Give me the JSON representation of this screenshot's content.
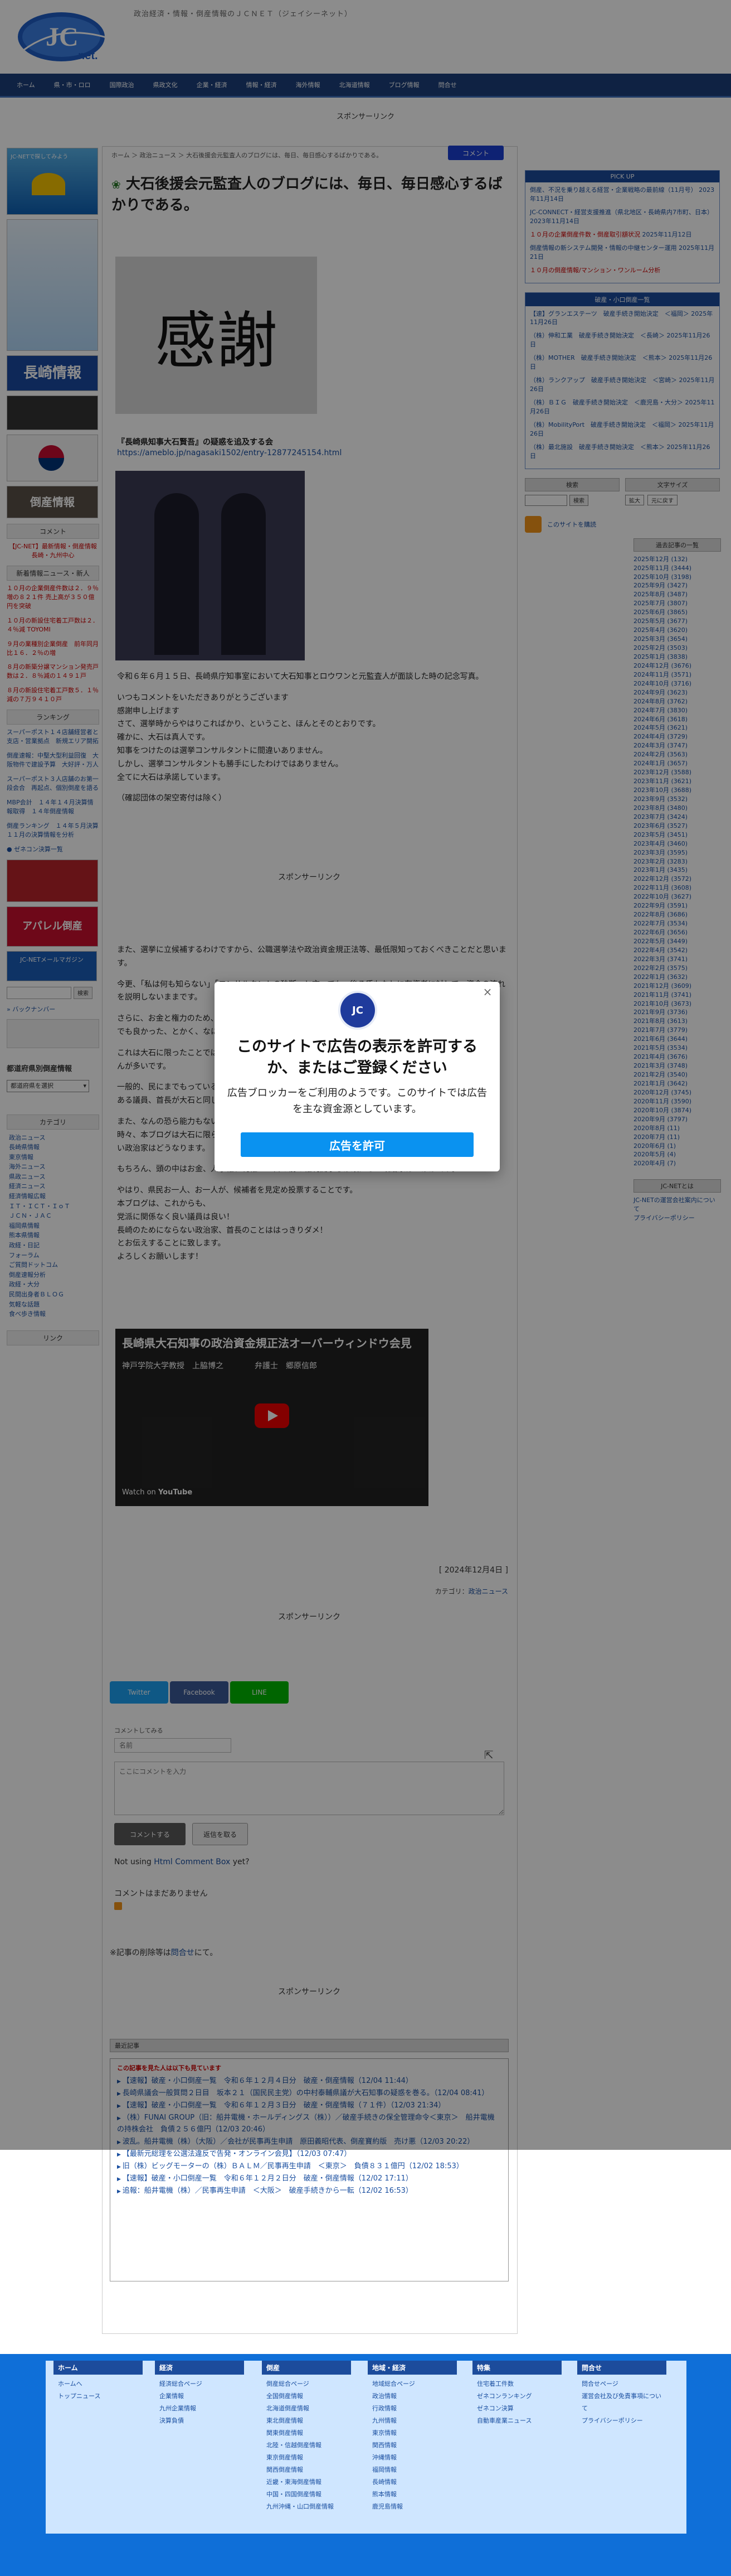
{
  "header": {
    "logo_text": "JC",
    "logo_subtext": "net.",
    "tagline": "政治経済・情報・倒産情報のＪＣＮＥＴ（ジェイシーネット）"
  },
  "nav": [
    "ホーム",
    "県・市・ロロ",
    "国際政治",
    "県政文化",
    "企業・経済",
    "情報・経済",
    "海外情報",
    "北海道情報",
    "ブログ情報",
    "問合せ"
  ],
  "sponsor_label": "スポンサーリンク",
  "breadcrumb": "ホーム ＞ 政治ニュース ＞ 大石後援会元監査人のブログには、毎日、毎日感心するばかりである。",
  "comment_button": "コメント",
  "post": {
    "title": "大石後援会元監査人のブログには、毎日、毎日感心するばかりである。",
    "kansha_char": "感謝",
    "headline": "『長崎県知事大石賢吾』の疑惑を追及する会",
    "url": "https://ameblo.jp/nagasaki1502/entry-12877245154.html",
    "body1": [
      "令和６年６月１５日、長崎県庁知事室において大石知事とロウワンと元監査人が面談した時の記念写真。",
      "いつもコメントをいただきありがとうございます\n感謝申し上げます\nさて、選挙時からやはりこればかり、ということ、ほんとそのとおりです。\n確かに、大石は真人です。\n知事をつけたのは選挙コンサルタントに間違いありません。\nしかし、選挙コンサルタントも勝手にしたわけではありません。\n全てに大石は承諾しています。",
      "（確認団体の架空寄付は除く）"
    ],
    "body2": [
      "また、選挙に立候補するわけですから、公職選挙法や政治資金規正法等、最低限知っておくべきことだと思います。",
      "今更、「私は何も知らない」「コンサルタントの独断」と言っても、後ろ盾もなしに有権者に対して、資金の流れを説明しないままです。",
      "さらに、お金と権力のため、県民を犠牲にしているのです。\nでも良かった、とかく、なにかの役に立つから、",
      "これは大石に限ったことではありません。\nんが多いです。",
      "一般的、民にまでもっているのです、必ずしも\nある議員、首長が大石と同じような",
      "また、なんの恐ら能力もない、つまり、\n時々、本ブログは大石に限らず、\nい政治家はどうなります。",
      "もちろん、頭の中はお金、人事権、利権……目の前の権利闘争しか頭にない政治家はいかがです。",
      "やはり、県民お一人、お一人が、候補者を見定め投票することです。\n本ブログは、これからも、\n党派に関係なく良い議員は良い！\n長崎のためにならない政治家、首長のことははっきりダメ！\nとお伝えすることに致します。\nよろしくお願いします！"
    ],
    "video_title": "長崎県大石知事の政治資金規正法オーバーウィンドウ会見",
    "video_names": "神戸学院大学教授　上脇博之　　　　弁護士　郷原信郎",
    "video_watch": "Watch on",
    "video_platform": "YouTube",
    "date": "[ 2024年12月4日 ]",
    "category_prefix": "カテゴリ：",
    "category": "政治ニュース"
  },
  "share": {
    "twitter": "Twitter",
    "facebook": "Facebook",
    "line": "LINE"
  },
  "comment_form": {
    "label": "コメントしてみる",
    "name_placeholder": "名前",
    "text_placeholder": "ここにコメントを入力",
    "submit": "コメントする",
    "reply": "返信を取る",
    "not_using": "Not using",
    "html_comment_box": "Html Comment Box",
    "yet": "yet?",
    "no_comments": "コメントはまだありません",
    "disclaimer": "※記事の削除等は",
    "disclaimer_link": "問合せ",
    "disclaimer_tail": "にて。"
  },
  "recent": {
    "header": "最近記事",
    "title": "この記事を見た人は以下も見ています",
    "items": [
      "【速報】破産・小口倒産一覧　令和６年１２月４日分　破産・倒産情報（12/04 11:44）",
      "長崎県議会一般質問２日目　坂本２１（国民民主党）の中村泰輔県議が大石知事の疑惑を巻る。（12/04 08:41）",
      "【速報】破産・小口倒産一覧　令和６年１２月３日分　破産・倒産情報（７１件）（12/03 21:34）",
      "（株）FUNAI GROUP（旧：船井電機・ホールディングス（株））／破産手続きの保全管理命令＜東京＞　船井電機の持株会社　負債２５６億円（12/03 20:46）",
      "波乱。船井電機（株）（大阪）／会社が民事再生申請　原田義昭代表、倒産寶約版　売け悪（12/03 20:22）",
      "【最新元総理を公選法違反で告発・オンライン会見】（12/03 07:47）",
      "旧（株）ビッグモーターの（株）ＢＡＬＭ／民事再生申請　＜東京＞　負債８３１億円（12/02 18:53）",
      "【速報】破産・小口倒産一覧　令和６年１２月２日分　破産・倒産情報（12/02 17:11）",
      "追報：船井電機（株）／民事再生申請　＜大阪＞　破産手続きから一転（12/02 16:53）"
    ]
  },
  "left": {
    "banner1": "JC-NETで探してみよう",
    "banner2": "長崎情報",
    "banner3": "倒産情報",
    "banner4": "アパレル倒産",
    "banner5": "JC-NETメールマガジン",
    "title_dispatch": "コメント",
    "red_news": "【JC-NET】最新情報・倒産情報 長崎・九州中心",
    "title_news": "新着情報ニュース・新人",
    "news_red": [
      "１０月の企業倒産件数は２．９％増の８２１件 売上高が３５０億円を突破",
      "１０月の新設住宅着工戸数は２．４％減 TOYOMI",
      "９月の業種別企業倒産　前年同月比１６．２％の増",
      "８月の新築分譲マンション発売戸数は２．８％減の１４９１戸",
      "８月の新設住宅着工戸数５．１％減の７万９４１０戸"
    ],
    "title_ranking": "ランキング",
    "news_blue": [
      "スーパーポスト１４店舗経営者と支店・営業拠点　新規エリア開拓",
      "倒産速報：中堅大型利益回復　大阪物件で建設予算　大好評・万人",
      "スーパーポスト３人店舗のお第一段会合　再起点、個別倒産を語る",
      "MBP会計　１４年１４月決算情報取得　１４年倒産情報",
      "倒産ランキング　１４年５月決算　１１月の決算情報を分析"
    ],
    "rss": "ゼネコン決算一覧",
    "search_label": "検索",
    "backnumber": "バックナンバー",
    "prefs_title": "都道府県別倒産情報",
    "prefs_select": "都道府県を選択",
    "cat_title": "カテゴリ",
    "categories": [
      "政治ニュース",
      "長崎県情報",
      "東京情報",
      "海外ニュース",
      "県政ニュース",
      "経済ニュース",
      "経済情報広報",
      "ＩＴ・ＩＣＴ・ＩｏＴ",
      "ＪＣＮ・ＪＡＣ",
      "福岡県情報",
      "熊本県情報",
      "政経・日記",
      "フォーラム",
      "ご質問ドットコム",
      "倒産速報分析",
      "政経・大分",
      "民間出身者ＢＬＯＧ",
      "気軽な話題",
      "食べ歩き情報"
    ],
    "links_title": "リンク"
  },
  "right": {
    "pickup_title": "PICK UP",
    "pickup": [
      {
        "t": "倒産、不況を乗り越える経営・企業戦略の最前線（11月号）",
        "d": "2023年11月14日",
        "red": false
      },
      {
        "t": "JC-CONNECT・経営支援推進（県北地区・長崎県内7市町、日本）",
        "d": "2023年11月14日",
        "red": false
      },
      {
        "t": "１０月の企業倒産件数・倒産取引額状況",
        "d": "2025年11月12日",
        "red": true
      },
      {
        "t": "倒産情報の新システム開発・情報の中継センター運用",
        "d": "2025年11月21日",
        "red": false
      },
      {
        "t": "１０月の倒産情報/マンション・ワンルーム分析",
        "d": "",
        "red": true
      }
    ],
    "news_title": "破産・小口倒産一覧",
    "news": [
      {
        "t": "【速】グランエステーツ　破産手続き開始決定　＜福岡＞",
        "d": "2025年11月26日"
      },
      {
        "t": "（株）伸和工業　破産手続き開始決定　＜長崎＞",
        "d": "2025年11月26日"
      },
      {
        "t": "（株）MOTHER　破産手続き開始決定　＜熊本＞",
        "d": "2025年11月26日"
      },
      {
        "t": "（株）ランクアップ　破産手続き開始決定　＜宮崎＞",
        "d": "2025年11月26日"
      },
      {
        "t": "（株）ＢＩＧ　破産手続き開始決定　＜鹿児島・大分＞",
        "d": "2025年11月26日"
      },
      {
        "t": "（株）MobilityPort　破産手続き開始決定　＜福岡＞",
        "d": "2025年11月26日"
      },
      {
        "t": "（株）最北施設　破産手続き開始決定　＜熊本＞",
        "d": "2025年11月26日"
      }
    ],
    "search_title": "検索",
    "search_button": "検索",
    "font_title": "文字サイズ",
    "font_large": "拡大",
    "font_reset": "元に戻す",
    "rss_label": "このサイトを購読",
    "archive_title": "過去記事の一覧",
    "archive": [
      "2025年12月 (132)",
      "2025年11月 (3444)",
      "2025年10月 (3198)",
      "2025年9月 (3427)",
      "2025年8月 (3487)",
      "2025年7月 (3807)",
      "2025年6月 (3865)",
      "2025年5月 (3677)",
      "2025年4月 (3620)",
      "2025年3月 (3654)",
      "2025年2月 (3503)",
      "2025年1月 (3838)",
      "2024年12月 (3676)",
      "2024年11月 (3571)",
      "2024年10月 (3716)",
      "2024年9月 (3623)",
      "2024年8月 (3762)",
      "2024年7月 (3830)",
      "2024年6月 (3618)",
      "2024年5月 (3621)",
      "2024年4月 (3729)",
      "2024年3月 (3747)",
      "2024年2月 (3563)",
      "2024年1月 (3657)",
      "2023年12月 (3588)",
      "2023年11月 (3621)",
      "2023年10月 (3688)",
      "2023年9月 (3532)",
      "2023年8月 (3480)",
      "2023年7月 (3424)",
      "2023年6月 (3527)",
      "2023年5月 (3451)",
      "2023年4月 (3460)",
      "2023年3月 (3595)",
      "2023年2月 (3283)",
      "2023年1月 (3435)",
      "2022年12月 (3572)",
      "2022年11月 (3608)",
      "2022年10月 (3627)",
      "2022年9月 (3591)",
      "2022年8月 (3686)",
      "2022年7月 (3534)",
      "2022年6月 (3656)",
      "2022年5月 (3449)",
      "2022年4月 (3542)",
      "2022年3月 (3741)",
      "2022年2月 (3575)",
      "2022年1月 (3632)",
      "2021年12月 (3609)",
      "2021年11月 (3741)",
      "2021年10月 (3673)",
      "2021年9月 (3736)",
      "2021年8月 (3613)",
      "2021年7月 (3779)",
      "2021年6月 (3644)",
      "2021年5月 (3534)",
      "2021年4月 (3676)",
      "2021年3月 (3748)",
      "2021年2月 (3540)",
      "2021年1月 (3642)",
      "2020年12月 (3745)",
      "2020年11月 (3590)",
      "2020年10月 (3874)",
      "2020年9月 (3797)",
      "2020年8月 (11)",
      "2020年7月 (11)",
      "2020年6月 (1)",
      "2020年5月 (4)",
      "2020年4月 (7)"
    ],
    "about_title": "JC-NETとは",
    "about": [
      "JC-NETの運営会社案内について",
      "プライバシーポリシー"
    ]
  },
  "footer": {
    "cols": [
      {
        "head": "ホーム",
        "items": [
          "ホームへ",
          "トップニュース"
        ]
      },
      {
        "head": "経済",
        "items": [
          "経済総合ページ",
          "企業情報",
          "九州企業情報",
          "決算負債"
        ]
      },
      {
        "head": "倒産",
        "items": [
          "倒産総合ページ",
          "全国倒産情報",
          "北海道倒産情報",
          "東北倒産情報",
          "関東倒産情報",
          "北陸・信越倒産情報",
          "東京倒産情報",
          "関西倒産情報",
          "近畿・東海倒産情報",
          "中国・四国倒産情報",
          "九州沖縄・山口倒産情報"
        ]
      },
      {
        "head": "地域・経済",
        "items": [
          "地域総合ページ",
          "政治情報",
          "行政情報",
          "九州情報",
          "東京情報",
          "関西情報",
          "沖縄情報",
          "福岡情報",
          "長崎情報",
          "熊本情報",
          "鹿児島情報"
        ]
      },
      {
        "head": "特集",
        "items": [
          "住宅着工件数",
          "ゼネコンランキング",
          "ゼネコン決算",
          "自動車産業ニュース"
        ]
      },
      {
        "head": "問合せ",
        "items": [
          "問合せページ",
          "運営会社及び免責事項について",
          "プライバシーポリシー"
        ]
      }
    ]
  },
  "modal": {
    "logo": "JC",
    "close": "×",
    "title": "このサイトで広告の表示を許可するか、またはご登録ください",
    "text": "広告ブロッカーをご利用のようです。このサイトでは広告を主な資金源としています。",
    "button": "広告を許可"
  },
  "colors": {
    "nav": "#1c3f7a",
    "accent_red": "#c00",
    "link": "#1a4fa0",
    "modal_button": "#0a92f0",
    "footer": "#0f6fd8"
  }
}
